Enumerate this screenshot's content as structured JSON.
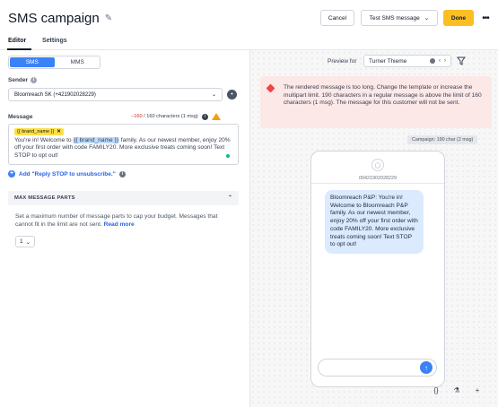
{
  "header": {
    "title": "SMS campaign",
    "cancel_label": "Cancel",
    "test_label": "Test SMS message",
    "done_label": "Done",
    "more_label": "•••"
  },
  "tabs": [
    {
      "label": "Editor",
      "active": true
    },
    {
      "label": "Settings",
      "active": false
    }
  ],
  "channel_toggle": {
    "options": [
      "SMS",
      "MMS"
    ],
    "selected": "SMS"
  },
  "sender": {
    "label": "Sender",
    "value": "Bloomreach SK (+421902028229)"
  },
  "message": {
    "label": "Message",
    "count_over": "−160",
    "count_rest": "/ 160 characters (1 msg)",
    "chip_label": "{{ brand_name }}",
    "chip_close": "✕",
    "text_part1": "You're in! Welcome to ",
    "text_highlight": "{{ brand_name }}",
    "text_part2": " family. As our newest member, enjoy 20% off your first order with code FAMILY20. More exclusive treats coming soon! Text STOP to opt out!"
  },
  "add_stop_link": "Add \"Reply STOP to unsubscribe.\"",
  "max_parts": {
    "heading": "MAX MESSAGE PARTS",
    "text": "Set a maximum number of message parts to cap your budget. Messages that cannot fit in the limit are not sent.",
    "read_more": "Read more",
    "value": "1"
  },
  "preview": {
    "label": "Preview for",
    "customer": "Turner Thieme"
  },
  "alert": {
    "text": "The rendered message is too long. Change the template or increase the multipart limit. 190 characters in a regular message is above the limit of 160 characters (1 msg). The message for this customer will not be sent."
  },
  "campaign_tag": "Campaign: 190 char (2 msg)",
  "phone": {
    "number": "00421902028229",
    "bubble": "Bloomreach P&P: You're in! Welcome to Bloomreach P&P family. As our newest member, enjoy 20% off your first order with code FAMILY20. More exclusive treats coming soon! Text STOP to opt out!"
  },
  "colors": {
    "accent": "#3b82f6",
    "done": "#fbbf24",
    "alert_bg": "#fde8e8",
    "error": "#dc2626"
  },
  "icons": [
    "pencil-icon",
    "chevron-down-icon",
    "plus-circle-icon",
    "info-icon",
    "warning-icon",
    "filter-icon",
    "send-icon",
    "code-icon",
    "flask-icon",
    "plus-icon"
  ]
}
